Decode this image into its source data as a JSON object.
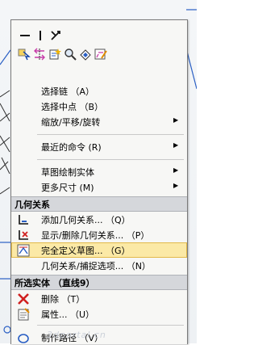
{
  "toolbar": {
    "row1": [
      "line-icon",
      "smart-dimension-icon"
    ],
    "row2": [
      "select-icon",
      "mirror-icon",
      "add-relation-icon",
      "zoom-icon",
      "hide-show-icon",
      "edit-sketch-icon"
    ]
  },
  "menu": {
    "items_top": [
      {
        "label": "选择链 （A）"
      },
      {
        "label": "选择中点 （B）"
      },
      {
        "label": "缩放/平移/旋转",
        "submenu": true
      }
    ],
    "recent": {
      "label": "最近的命令 (R)",
      "submenu": true
    },
    "sketch": [
      {
        "label": "草图绘制实体",
        "submenu": true
      },
      {
        "label": "更多尺寸 (M)",
        "submenu": true
      }
    ],
    "relations_section": "几何关系",
    "relations": [
      {
        "label": "添加几何关系... （Q）",
        "icon": "add-relation-icon"
      },
      {
        "label": "显示/删除几何关系... （P）",
        "icon": "display-delete-relation-icon"
      },
      {
        "label": "完全定义草图... （G）",
        "icon": "fully-define-sketch-icon",
        "highlighted": true
      },
      {
        "label": "几何关系/捕捉选项... （N）"
      }
    ],
    "selected_section": "所选实体 （直线9）",
    "selected": [
      {
        "label": "删除 （T）",
        "icon": "delete-icon"
      },
      {
        "label": "属性... （U）",
        "icon": "properties-icon"
      },
      {
        "label": "制作路径 （V）",
        "icon": "make-path-icon"
      }
    ]
  },
  "watermark": "3dportal.cn",
  "colors": {
    "highlight": "#fbe9a6",
    "section": "#d5d7db",
    "delete_red": "#d02020"
  }
}
